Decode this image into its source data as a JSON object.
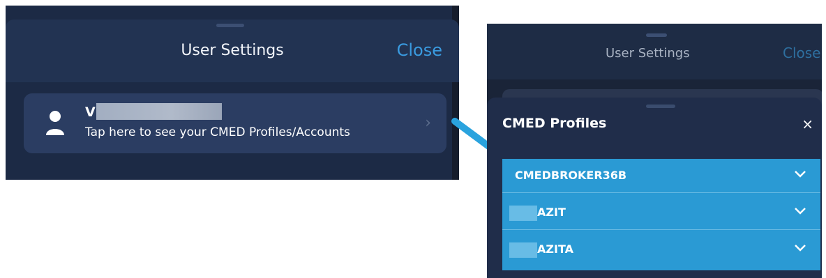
{
  "left": {
    "title": "User Settings",
    "close_label": "Close",
    "user_card": {
      "name_visible": "V",
      "subtitle": "Tap here to see your CMED Profiles/Accounts",
      "chevron": "›"
    }
  },
  "right": {
    "background_title": "User Settings",
    "background_close": "Close",
    "sheet": {
      "title": "CMED Profiles",
      "close_glyph": "×",
      "profiles": [
        {
          "label": "CMEDBROKER36B"
        },
        {
          "label": "AZIT"
        },
        {
          "label": "AZITA"
        }
      ]
    }
  },
  "colors": {
    "panel_bg": "#1c2a45",
    "header_bg": "#223352",
    "accent_blue": "#3a9be0",
    "profile_list_bg": "#2a9ad4",
    "arrow_color": "#2aa3de"
  },
  "icons": {
    "user": "user-icon",
    "chevron_right": "chevron-right-icon",
    "chevron_down": "chevron-down-icon",
    "close": "close-icon",
    "arrow": "pointer-arrow-icon"
  }
}
